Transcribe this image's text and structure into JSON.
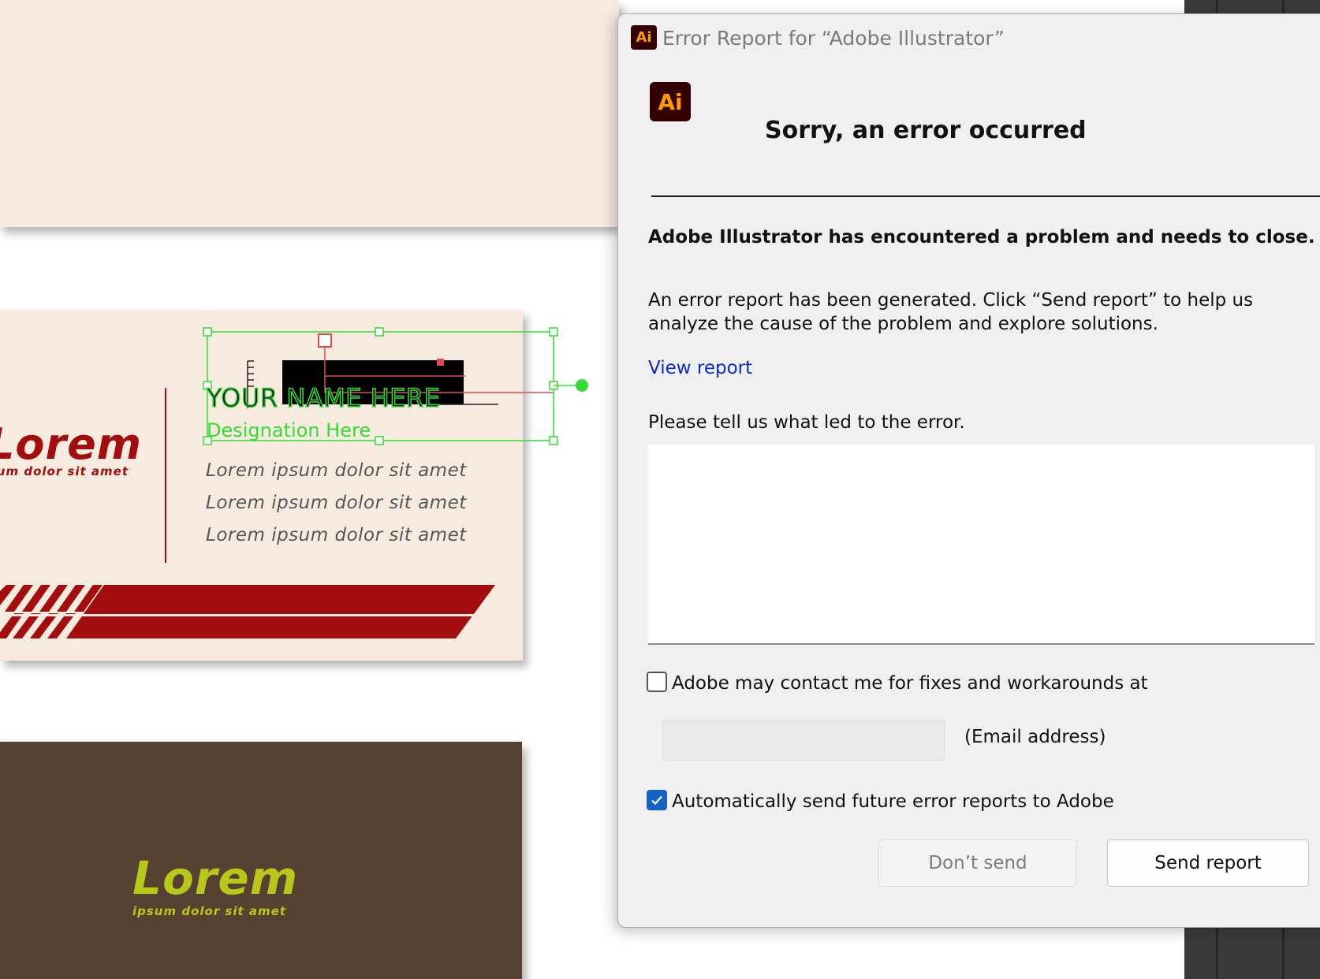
{
  "canvas": {
    "card_mid": {
      "logo": "Lorem",
      "tagline": "ipsum dolor sit amet",
      "name": "YOUR NAME HERE",
      "designation": "Designation Here",
      "lines": [
        "Lorem ipsum dolor sit amet",
        "Lorem ipsum dolor sit amet",
        "Lorem ipsum dolor sit amet"
      ]
    },
    "card_bot": {
      "logo": "Lorem",
      "tagline": "ipsum dolor sit amet"
    },
    "colors": {
      "card_bg": "#f7ebe0",
      "brand_red": "#a30d0d",
      "brown": "#574131",
      "lime": "#b8c81a",
      "selection_green": "#33dd33"
    }
  },
  "dialog": {
    "app_icon": "Ai",
    "title": "Error Report for “Adobe Illustrator”",
    "headline": "Sorry, an error occurred",
    "problem": "Adobe Illustrator has encountered a problem and needs to close.",
    "description": "An error report has been generated. Click “Send report” to help us analyze the cause of the problem and explore solutions.",
    "view_report": "View report",
    "prompt": "Please tell us what led to the error.",
    "feedback_value": "",
    "contact_label": "Adobe may contact me for fixes and workarounds at",
    "contact_checked": false,
    "email_value": "",
    "email_label": "(Email address)",
    "auto_send_label": "Automatically send future error reports to Adobe",
    "auto_send_checked": true,
    "dont_send": "Don’t send",
    "send_report": "Send report"
  }
}
